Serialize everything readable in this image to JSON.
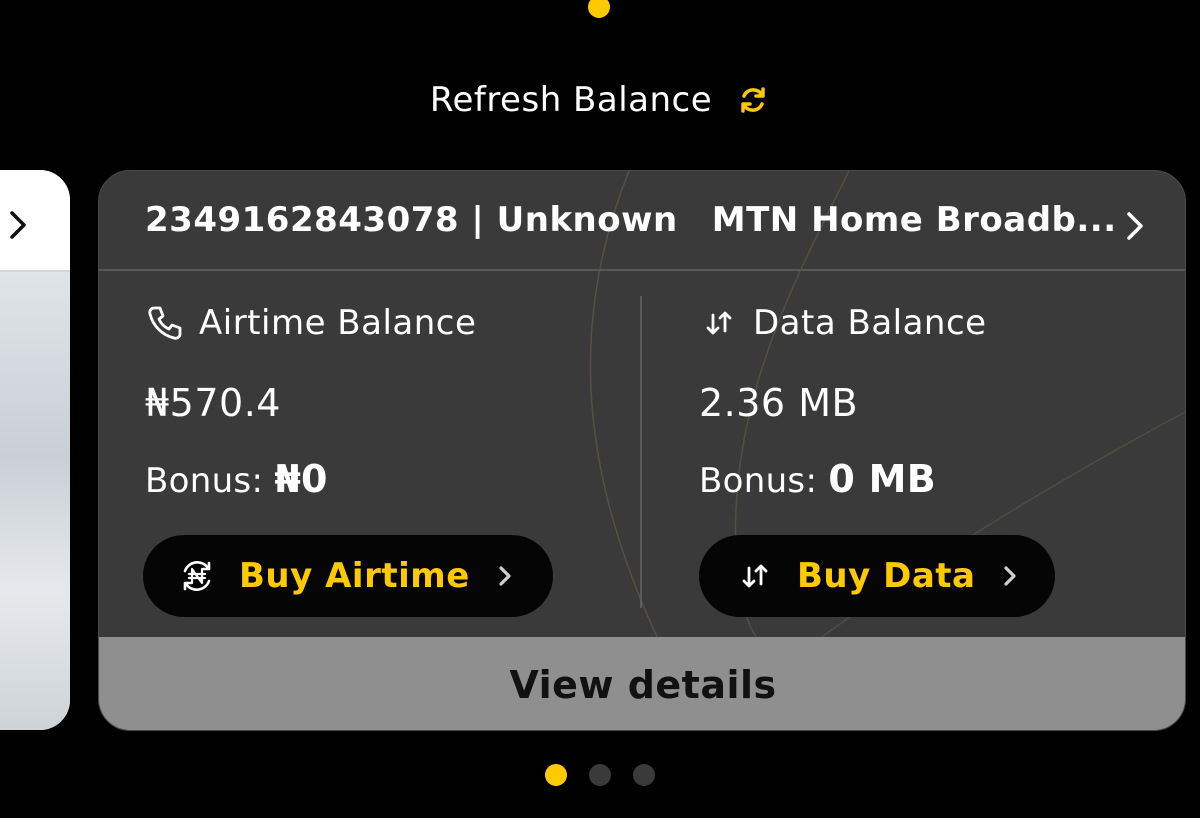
{
  "colors": {
    "accent": "#ffc900",
    "card_background": "#3a3a3a",
    "button_background": "#050505",
    "footer_background": "#8f8f8f",
    "inactive_dot": "#3a3a3a"
  },
  "refresh": {
    "label": "Refresh Balance",
    "icon": "refresh-icon"
  },
  "card": {
    "line_id": "2349162843078 | Unknown",
    "plan_name": "MTN Home Broadb...",
    "chevron_icon": "chevron-right-icon",
    "airtime": {
      "label": "Airtime Balance",
      "icon": "phone-icon",
      "value": "₦570.4",
      "bonus_label": "Bonus:",
      "bonus_value": "₦0",
      "button_label": "Buy Airtime",
      "button_icon": "naira-cycle-icon"
    },
    "data": {
      "label": "Data Balance",
      "icon": "up-down-arrows-icon",
      "value": "2.36 MB",
      "bonus_label": "Bonus:",
      "bonus_value": "0 MB",
      "button_label": "Buy Data",
      "button_icon": "up-down-arrows-icon"
    },
    "footer_label": "View details"
  },
  "pager": {
    "total": 3,
    "active_index": 0
  }
}
